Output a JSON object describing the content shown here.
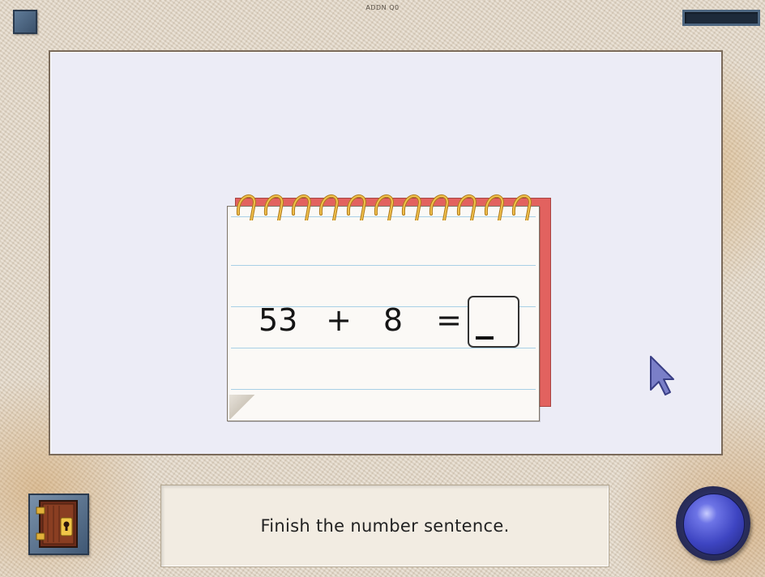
{
  "window": {
    "title": "ADDN Q0"
  },
  "progress": {
    "value": 0
  },
  "problem": {
    "operand1": "53",
    "operator": "+",
    "operand2": "8",
    "equals": "=",
    "answer_value": "_"
  },
  "instruction": {
    "text": "Finish the number sentence."
  },
  "icons": {
    "corner": "menu-square-icon",
    "exit": "door-icon",
    "go": "blue-orb-icon",
    "pointer": "mouse-pointer-icon"
  },
  "colors": {
    "workspace": "#ececf6",
    "notepad_back": "#e2625f",
    "ring": "#e0a93a",
    "go_button": "#3e45c2"
  }
}
